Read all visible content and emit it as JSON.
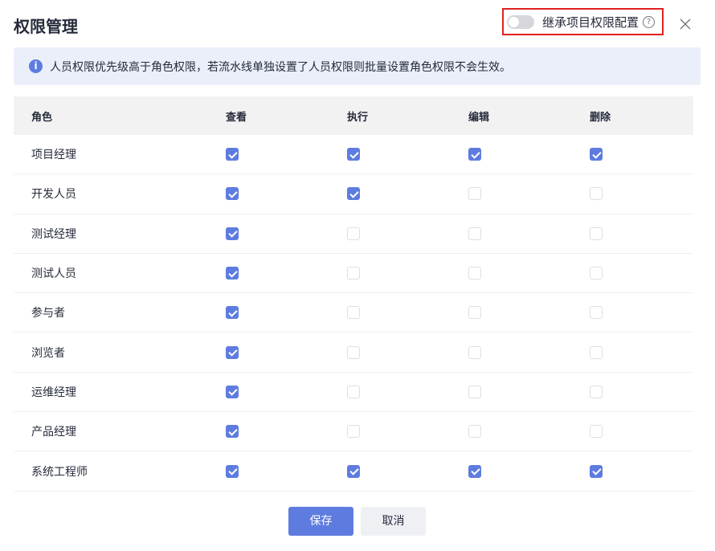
{
  "dialog": {
    "title": "权限管理",
    "inherit_label": "继承项目权限配置",
    "inherit_enabled": false,
    "help_glyph": "?"
  },
  "info": {
    "text": "人员权限优先级高于角色权限，若流水线单独设置了人员权限则批量设置角色权限不会生效。"
  },
  "table": {
    "headers": [
      "角色",
      "查看",
      "执行",
      "编辑",
      "删除"
    ],
    "rows": [
      {
        "role": "项目经理",
        "perms": [
          true,
          true,
          true,
          true
        ]
      },
      {
        "role": "开发人员",
        "perms": [
          true,
          true,
          false,
          false
        ]
      },
      {
        "role": "测试经理",
        "perms": [
          true,
          false,
          false,
          false
        ]
      },
      {
        "role": "测试人员",
        "perms": [
          true,
          false,
          false,
          false
        ]
      },
      {
        "role": "参与者",
        "perms": [
          true,
          false,
          false,
          false
        ]
      },
      {
        "role": "浏览者",
        "perms": [
          true,
          false,
          false,
          false
        ]
      },
      {
        "role": "运维经理",
        "perms": [
          true,
          false,
          false,
          false
        ]
      },
      {
        "role": "产品经理",
        "perms": [
          true,
          false,
          false,
          false
        ]
      },
      {
        "role": "系统工程师",
        "perms": [
          true,
          true,
          true,
          true
        ]
      }
    ]
  },
  "footer": {
    "save_label": "保存",
    "cancel_label": "取消"
  },
  "colors": {
    "primary": "#5e7ce0",
    "info_bg": "#ebeffa",
    "highlight_border": "#e02020"
  }
}
